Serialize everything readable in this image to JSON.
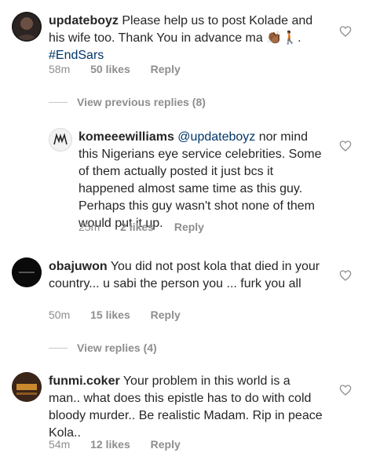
{
  "comments": [
    {
      "username": "updateboyz",
      "text": "Please help us to post Kolade and his wife too. Thank You in advance ma",
      "emoji": "👏🏾🚶🏾.",
      "hashtag": "#EndSars",
      "time": "58m",
      "likes": "50 likes",
      "reply": "Reply",
      "avatar_icon": "user-avatar-icon"
    },
    {
      "username": "komeeewilliams",
      "mention": "@updateboyz",
      "text": "nor mind this Nigerians eye service celebrities. Some of them actually posted it just bcs it happened almost same time as this guy. Perhaps this guy wasn't shot none of them would put it up.",
      "time": "25m",
      "likes": "2 likes",
      "reply": "Reply",
      "avatar_icon": "user-avatar-icon"
    },
    {
      "username": "obajuwon",
      "text": "You did not post kola that died in your country... u sabi the person you ... furk you all",
      "time": "50m",
      "likes": "15 likes",
      "reply": "Reply",
      "avatar_icon": "user-avatar-icon"
    },
    {
      "username": "funmi.coker",
      "text": "Your problem in this world is a man.. what does this epistle has to do with cold bloody murder.. Be realistic Madam. Rip in peace Kola..",
      "time": "54m",
      "likes": "12 likes",
      "reply": "Reply",
      "avatar_icon": "user-avatar-icon"
    }
  ],
  "view_previous_replies": "View previous replies (8)",
  "view_replies": "View replies (4)",
  "colors": {
    "text": "#262626",
    "meta": "#8e8e8e",
    "link": "#003569"
  }
}
